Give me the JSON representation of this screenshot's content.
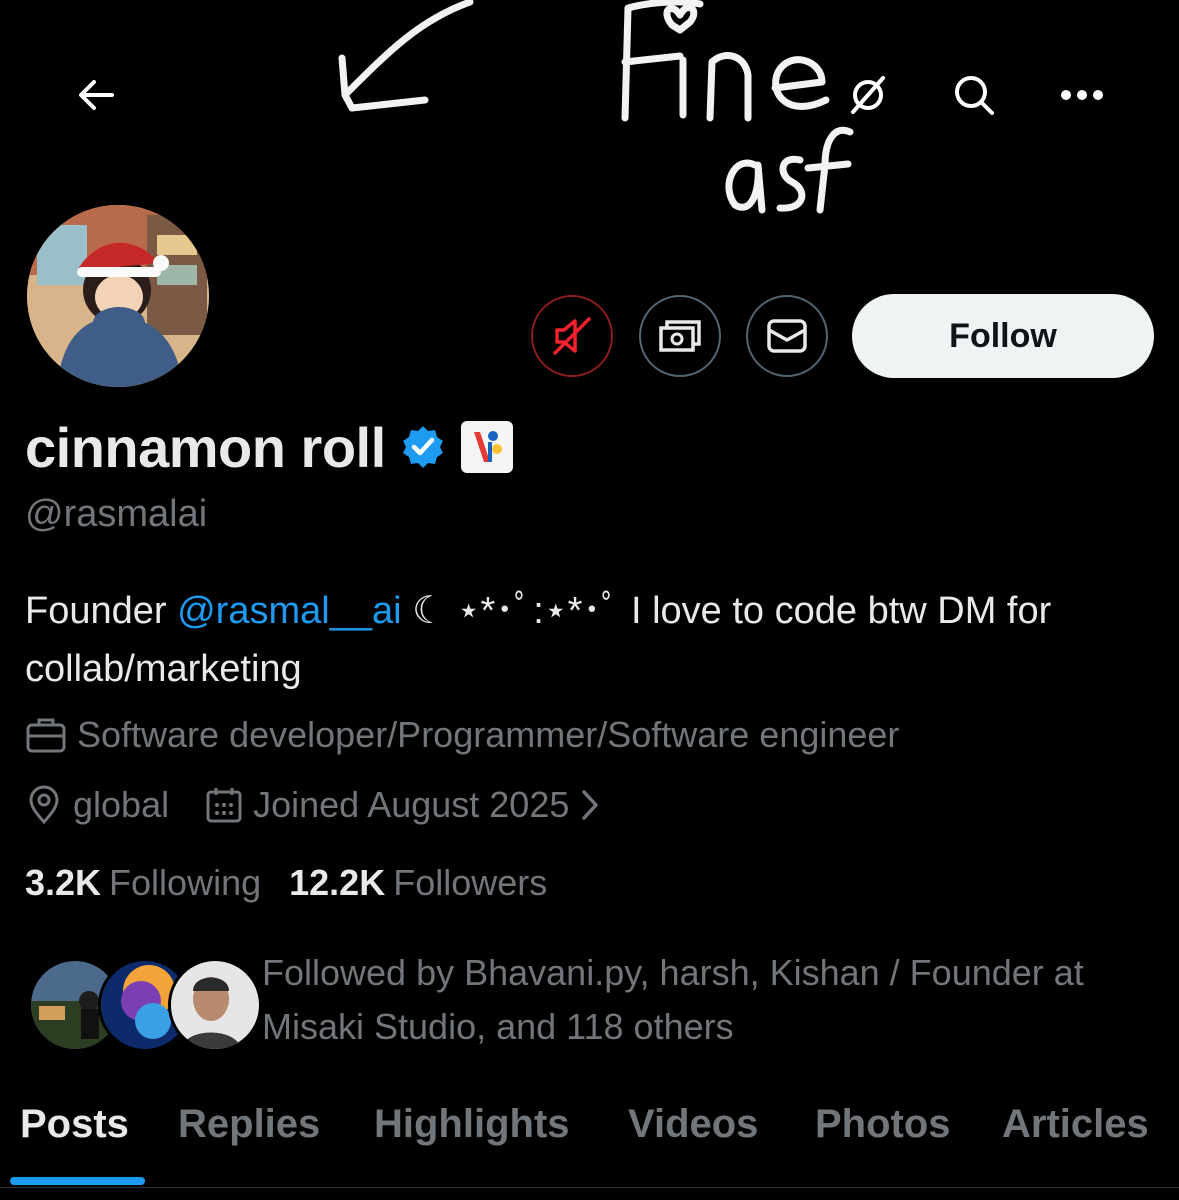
{
  "banner": {
    "handwriting_text": "Fine asf"
  },
  "profile": {
    "display_name": "cinnamon roll",
    "handle": "@rasmalai",
    "bio_prefix": "Founder ",
    "bio_mention": "@rasmal__ai",
    "bio_suffix": " ☾ ⋆*･ﾟ:⋆*･ﾟ  I love to code btw DM for collab/marketing",
    "job": "Software developer/Programmer/Software engineer",
    "location": "global",
    "joined": "Joined August 2025"
  },
  "actions": {
    "follow_label": "Follow"
  },
  "stats": {
    "following_count": "3.2K",
    "following_label": "Following",
    "followers_count": "12.2K",
    "followers_label": "Followers"
  },
  "followed_by": "Followed by Bhavani.py, harsh, Kishan / Founder at Misaki Studio, and 118 others",
  "tabs": [
    "Posts",
    "Replies",
    "Highlights",
    "Videos",
    "Photos",
    "Articles"
  ],
  "icons": [
    "back-arrow-icon",
    "grok-icon",
    "search-icon",
    "more-icon",
    "mute-icon",
    "subscription-icon",
    "message-icon",
    "verified-badge-icon",
    "affiliate-badge-icon",
    "briefcase-icon",
    "location-icon",
    "calendar-icon",
    "chevron-right-icon"
  ],
  "colors": {
    "accent": "#1d9bf0",
    "secondary_text": "#71767b",
    "background": "#000000",
    "muted_red": "#f4212e"
  }
}
